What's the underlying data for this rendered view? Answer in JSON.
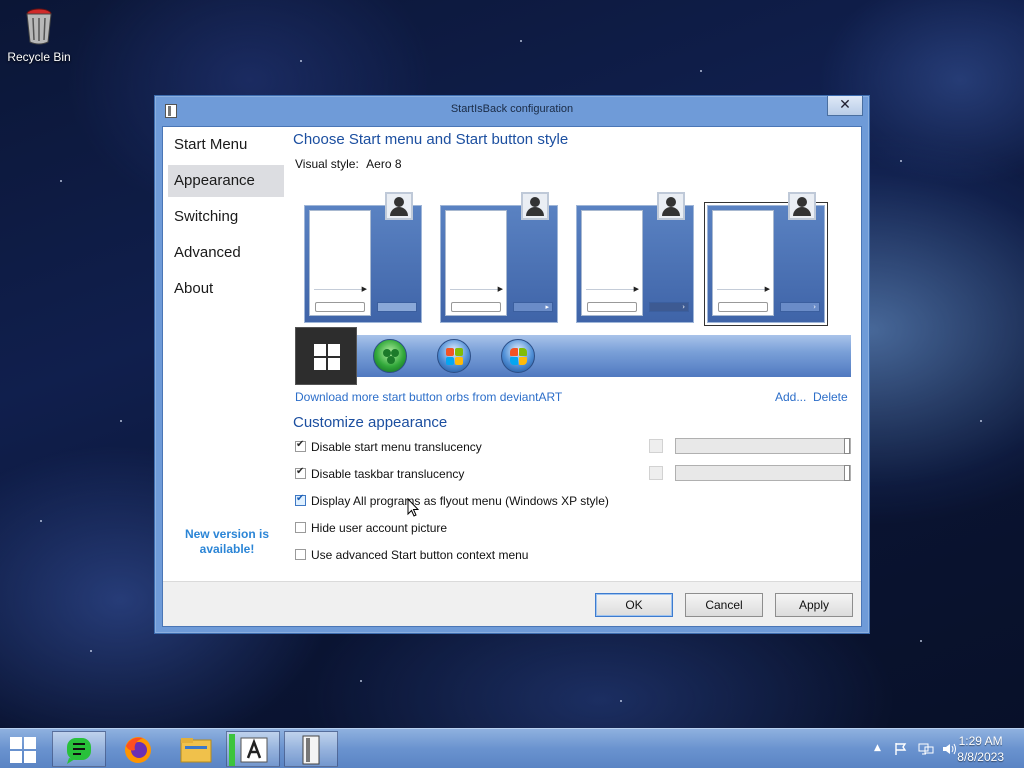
{
  "desktop": {
    "icons": [
      {
        "label": "Recycle Bin",
        "icon": "recycle-bin-icon"
      }
    ]
  },
  "window": {
    "title": "StartIsBack configuration",
    "close_symbol": "✕",
    "sidebar": {
      "items": [
        {
          "label": "Start Menu",
          "active": false
        },
        {
          "label": "Appearance",
          "active": true
        },
        {
          "label": "Switching",
          "active": false
        },
        {
          "label": "Advanced",
          "active": false
        },
        {
          "label": "About",
          "active": false
        }
      ],
      "new_version": "New version is available!"
    },
    "main": {
      "style_heading": "Choose Start menu and Start button style",
      "visual_style_label": "Visual style:",
      "visual_style_value": "Aero 8",
      "styles": [
        "style-1",
        "style-2",
        "style-3",
        "style-4"
      ],
      "selected_style_index": 3,
      "orbs": [
        "windows-8-orb-icon",
        "clover-orb-icon",
        "windows-orb-icon",
        "windows-7-orb-icon"
      ],
      "selected_orb_index": 0,
      "download_link": "Download more start button orbs from deviantART",
      "add_link": "Add...",
      "delete_link": "Delete",
      "customize_heading": "Customize appearance",
      "options": [
        {
          "label": "Disable start menu translucency",
          "checked": true
        },
        {
          "label": "Disable taskbar translucency",
          "checked": true
        },
        {
          "label": "Display All programs as flyout menu (Windows XP style)",
          "checked": true
        },
        {
          "label": "Hide user account picture",
          "checked": false
        },
        {
          "label": "Use advanced Start button context menu",
          "checked": false
        }
      ],
      "sliders": [
        {
          "level": 1.0
        },
        {
          "level": 1.0
        }
      ]
    },
    "buttons": {
      "ok": "OK",
      "cancel": "Cancel",
      "apply": "Apply"
    }
  },
  "taskbar": {
    "start_icon": "windows-start-icon",
    "apps": [
      {
        "icon": "notes-app-icon",
        "open": true
      },
      {
        "icon": "firefox-icon",
        "open": false
      },
      {
        "icon": "file-explorer-icon",
        "open": false
      },
      {
        "icon": "adobe-app-icon",
        "open": true
      },
      {
        "icon": "startisback-app-icon",
        "open": true
      }
    ],
    "tray_icons": [
      "chevron-up-icon",
      "flag-icon",
      "network-icon",
      "volume-icon"
    ],
    "time": "1:29 AM",
    "date": "8/8/2023"
  }
}
